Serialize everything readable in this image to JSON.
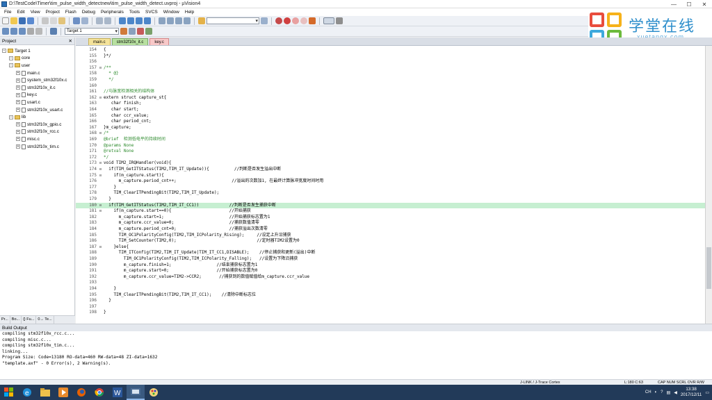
{
  "window": {
    "title": "D:\\TestCode\\Timer\\tim_pulse_width_detectnew\\tim_pulse_width_detect.uvproj - µVision4"
  },
  "menu": [
    "File",
    "Edit",
    "View",
    "Project",
    "Flash",
    "Debug",
    "Peripherals",
    "Tools",
    "SVCS",
    "Window",
    "Help"
  ],
  "toolbar2": {
    "target": "Target 1"
  },
  "logo": {
    "text": "学堂在线",
    "sub": "xuetangx.com"
  },
  "project": {
    "title": "Project",
    "tree": [
      {
        "label": "Target 1",
        "level": 0,
        "kind": "target"
      },
      {
        "label": "core",
        "level": 1,
        "kind": "folder"
      },
      {
        "label": "user",
        "level": 1,
        "kind": "folder"
      },
      {
        "label": "main.c",
        "level": 2,
        "kind": "file"
      },
      {
        "label": "system_stm32f10x.c",
        "level": 2,
        "kind": "file"
      },
      {
        "label": "stm32f10x_it.c",
        "level": 2,
        "kind": "file"
      },
      {
        "label": "key.c",
        "level": 2,
        "kind": "file"
      },
      {
        "label": "usart.c",
        "level": 2,
        "kind": "file"
      },
      {
        "label": "stm32f10x_usart.c",
        "level": 2,
        "kind": "file"
      },
      {
        "label": "lib",
        "level": 1,
        "kind": "folder"
      },
      {
        "label": "stm32f10x_gpio.c",
        "level": 2,
        "kind": "file"
      },
      {
        "label": "stm32f10x_rcc.c",
        "level": 2,
        "kind": "file"
      },
      {
        "label": "misc.c",
        "level": 2,
        "kind": "file"
      },
      {
        "label": "stm32f10x_tim.c",
        "level": 2,
        "kind": "file"
      }
    ],
    "tabs": [
      "Pr...",
      "Bo...",
      "{} Fu...",
      "0→ Te..."
    ]
  },
  "editor": {
    "tabs": [
      {
        "label": "main.c",
        "state": "normal"
      },
      {
        "label": "stm32f10x_it.c",
        "state": "active"
      },
      {
        "label": "key.c",
        "state": "key"
      }
    ],
    "highlight_line": "180",
    "lines": [
      {
        "n": "154",
        "t": "{"
      },
      {
        "n": "155",
        "t": "}*/"
      },
      {
        "n": "156",
        "t": ""
      },
      {
        "n": "157",
        "t": "/**"
      },
      {
        "n": "158",
        "t": "  * @}"
      },
      {
        "n": "159",
        "t": "  */"
      },
      {
        "n": "160",
        "t": ""
      },
      {
        "n": "161",
        "t": "//与脉宽检测相关的结构体"
      },
      {
        "n": "162",
        "t": "extern struct capture_st{"
      },
      {
        "n": "163",
        "t": "   char finish;"
      },
      {
        "n": "164",
        "t": "   char start;"
      },
      {
        "n": "165",
        "t": "   char ccr_value;"
      },
      {
        "n": "166",
        "t": "   char period_cnt;"
      },
      {
        "n": "167",
        "t": "}m_capture;"
      },
      {
        "n": "168",
        "t": "/*"
      },
      {
        "n": "169",
        "t": "@brief  检测低电平的持续时间"
      },
      {
        "n": "170",
        "t": "@params None"
      },
      {
        "n": "171",
        "t": "@retval None"
      },
      {
        "n": "172",
        "t": "*/"
      },
      {
        "n": "173",
        "t": "void TIM2_IRQHandler(void){"
      },
      {
        "n": "174",
        "t": "  if(TIM_GetITStatus(TIM2,TIM_IT_Update)){          //判断是否发生溢出中断"
      },
      {
        "n": "175",
        "t": "    if(m_capture.start){"
      },
      {
        "n": "176",
        "t": "      m_capture.period_cnt++;                      //溢出的次数加1, 在最终计算脉冲宽度时间时用"
      },
      {
        "n": "177",
        "t": "    }"
      },
      {
        "n": "178",
        "t": "    TIM_ClearITPendingBit(TIM2,TIM_IT_Update);"
      },
      {
        "n": "179",
        "t": "  }"
      },
      {
        "n": "180",
        "t": "  if(TIM_GetITStatus(TIM2,TIM_IT_CC1))            //判断是否发生捕获中断"
      },
      {
        "n": "181",
        "t": "    if(m_capture.start==0){                       //开始捕获"
      },
      {
        "n": "182",
        "t": "      m_capture.start=1;                          //开始捕获标志置为1"
      },
      {
        "n": "183",
        "t": "      m_capture.ccr_value=0;                      //捕获数值清零"
      },
      {
        "n": "184",
        "t": "      m_capture.period_cnt=0;                     //捕获溢出次数清零"
      },
      {
        "n": "185",
        "t": "      TIM_OC1PolarityConfig(TIM2,TIM_ICPolarity_Rising);     //设定上升沿捕获"
      },
      {
        "n": "186",
        "t": "      TIM_SetCounter(TIM2,0);                                //定时器TIM2设置为0"
      },
      {
        "n": "187",
        "t": "    }else{"
      },
      {
        "n": "188",
        "t": "      TIM_ITConfig(TIM2,TIM_IT_Update|TIM_IT_CC1,DISABLE);    //停止捕获和更新(溢出)中断"
      },
      {
        "n": "189",
        "t": "        TIM_OC1PolarityConfig(TIM2,TIM_ICPolarity_Falling);   //设置为下降沿捕获"
      },
      {
        "n": "190",
        "t": "        m_capture.finish=1;                  //结束捕获标志置为1"
      },
      {
        "n": "191",
        "t": "        m_capture.start=0;                   //开始捕获标志置为0"
      },
      {
        "n": "192",
        "t": "        m_capture.ccr_value=TIM2->CCR2;       //捕获到的数值赋值给m_capture.ccr_value"
      },
      {
        "n": "193",
        "t": ""
      },
      {
        "n": "194",
        "t": "    }"
      },
      {
        "n": "195",
        "t": "    TIM_ClearITPendingBit(TIM2,TIM_IT_CC1);    //清除中断标志位"
      },
      {
        "n": "196",
        "t": "  }"
      },
      {
        "n": "197",
        "t": ""
      },
      {
        "n": "198",
        "t": "}"
      }
    ]
  },
  "build": {
    "title": "Build Output",
    "lines": [
      "compiling stm32f10x_rcc.c...",
      "compiling misc.c...",
      "compiling stm32f10x_tim.c...",
      "linking...",
      "Program Size: Code=13180 RO-data=460 RW-data=48 ZI-data=1632",
      "\"template.axf\" - 0 Error(s), 2 Warning(s)."
    ]
  },
  "status": {
    "debugger": "J-LINK / J-Trace Cortex",
    "position": "L:180 C:63",
    "flags": "CAP  NUM  SCRL  OVR  R/W"
  },
  "taskbar": {
    "time": "13:38",
    "date": "2017/12/11",
    "lang": "CH"
  }
}
